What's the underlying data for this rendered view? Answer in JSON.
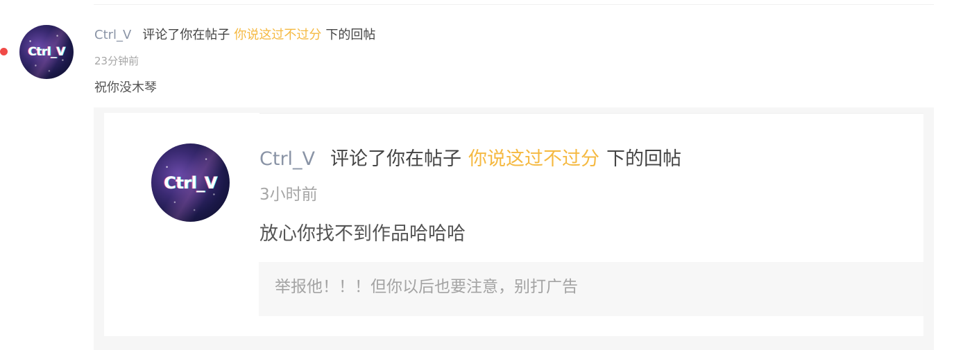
{
  "notification": {
    "username": "Ctrl_V",
    "action_prefix": "评论了你在帖子",
    "post_title": "你说这过不过分",
    "action_suffix": "下的回帖",
    "time": "23分钟前",
    "content": "祝你没木琴",
    "avatar_text": "Ctrl_V"
  },
  "quoted_reply": {
    "username": "Ctrl_V",
    "action_prefix": "评论了你在帖子",
    "post_title": "你说这过不过分",
    "action_suffix": "下的回帖",
    "time": "3小时前",
    "content": "放心你找不到作品哈哈哈",
    "avatar_text": "Ctrl_V",
    "parent_reply": "举报他！！！但你以后也要注意，别打广告"
  },
  "colors": {
    "unread_dot": "#f04a47",
    "username": "#8a94a6",
    "post_link": "#f5b941"
  }
}
